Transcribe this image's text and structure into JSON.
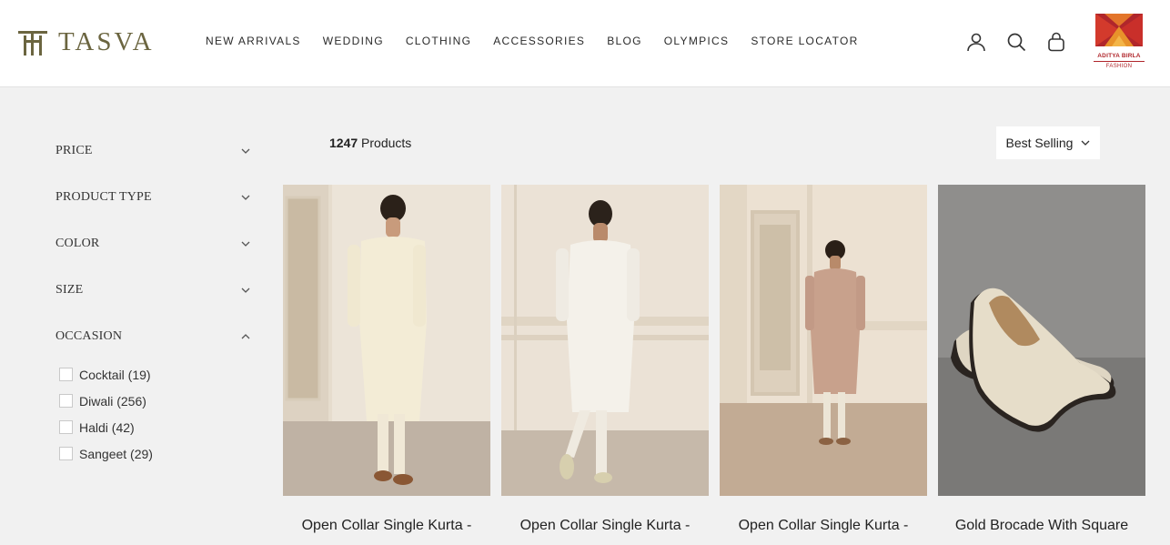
{
  "header": {
    "logo_text": "TASVA",
    "nav": [
      "NEW ARRIVALS",
      "WEDDING",
      "CLOTHING",
      "ACCESSORIES",
      "BLOG",
      "OLYMPICS",
      "STORE LOCATOR"
    ],
    "icons": [
      "account-icon",
      "search-icon",
      "bag-icon"
    ],
    "brand_badge": {
      "name": "ADITYA BIRLA",
      "sub": "FASHION"
    }
  },
  "filters": {
    "sections": [
      {
        "label": "PRICE",
        "expanded": false
      },
      {
        "label": "PRODUCT TYPE",
        "expanded": false
      },
      {
        "label": "COLOR",
        "expanded": false
      },
      {
        "label": "SIZE",
        "expanded": false
      },
      {
        "label": "OCCASION",
        "expanded": true
      }
    ],
    "occasion_options": [
      "Cocktail (19)",
      "Diwali (256)",
      "Haldi (42)",
      "Sangeet (29)"
    ]
  },
  "toolbar": {
    "count": "1247",
    "count_suffix": " Products",
    "sort_label": "Best Selling"
  },
  "products": [
    {
      "title": "Open Collar Single Kurta -"
    },
    {
      "title": "Open Collar Single Kurta -"
    },
    {
      "title": "Open Collar Single Kurta -"
    },
    {
      "title": "Gold Brocade With Square"
    }
  ],
  "colors": {
    "logo": "#6b6540",
    "badge_red": "#b0262b",
    "badge_orange": "#e8922a",
    "page_bg": "#f1f1f1"
  }
}
